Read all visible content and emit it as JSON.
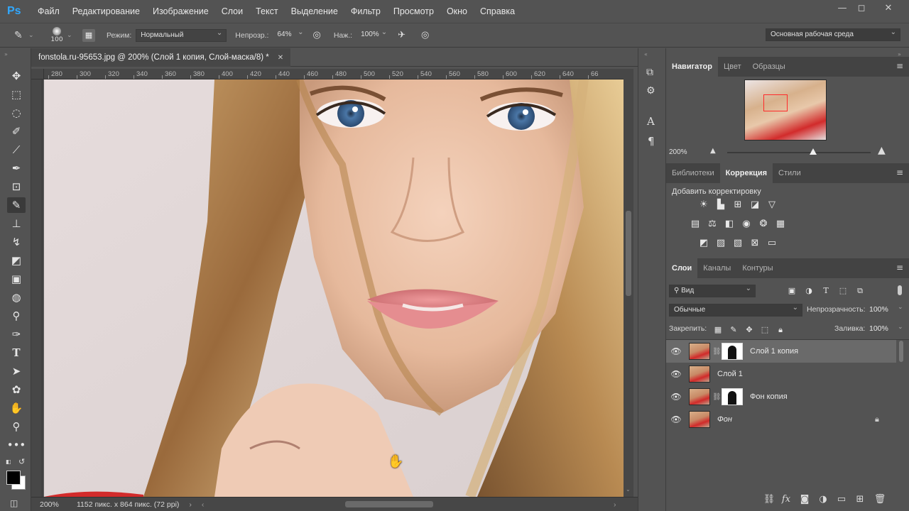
{
  "app": {
    "logo": "Ps"
  },
  "menu": [
    "Файл",
    "Редактирование",
    "Изображение",
    "Слои",
    "Текст",
    "Выделение",
    "Фильтр",
    "Просмотр",
    "Окно",
    "Справка"
  ],
  "window_controls": [
    "—",
    "◻",
    "✕"
  ],
  "options": {
    "brush_size": "100",
    "mode_label": "Режим:",
    "mode_value": "Нормальный",
    "opacity_label": "Непрозр.:",
    "opacity_value": "64%",
    "pressure_label": "Наж.:",
    "pressure_value": "100%",
    "workspace": "Основная рабочая среда"
  },
  "document": {
    "tab_title": "fonstola.ru-95653.jpg @ 200% (Слой 1 копия, Слой-маска/8) *",
    "close": "✕",
    "ruler_ticks": [
      "280",
      "300",
      "320",
      "340",
      "360",
      "380",
      "400",
      "420",
      "440",
      "460",
      "480",
      "500",
      "520",
      "540",
      "560",
      "580",
      "600",
      "620",
      "640",
      "66"
    ],
    "zoom": "200%",
    "doc_info": "1152 пикс. x 864 пикс. (72 ppi)"
  },
  "navigator": {
    "tabs": [
      "Навигатор",
      "Цвет",
      "Образцы"
    ],
    "zoom": "200%"
  },
  "correction": {
    "tabs": [
      "Библиотеки",
      "Коррекция",
      "Стили"
    ],
    "heading": "Добавить корректировку"
  },
  "layers_panel": {
    "tabs": [
      "Слои",
      "Каналы",
      "Контуры"
    ],
    "filter_value": "Вид",
    "blend_mode": "Обычные",
    "opacity_label": "Непрозрачность:",
    "opacity_value": "100%",
    "lock_label": "Закрепить:",
    "fill_label": "Заливка:",
    "fill_value": "100%",
    "layers": [
      {
        "name": "Слой 1 копия",
        "has_mask": true,
        "selected": true
      },
      {
        "name": "Слой 1",
        "has_mask": false,
        "selected": false
      },
      {
        "name": "Фон копия",
        "has_mask": true,
        "selected": false
      },
      {
        "name": "Фон",
        "has_mask": false,
        "selected": false,
        "locked": true
      }
    ]
  },
  "colors": {
    "foreground": "#000000",
    "background": "#ffffff",
    "panel_bg": "#535353",
    "accent": "#31a8ff"
  }
}
